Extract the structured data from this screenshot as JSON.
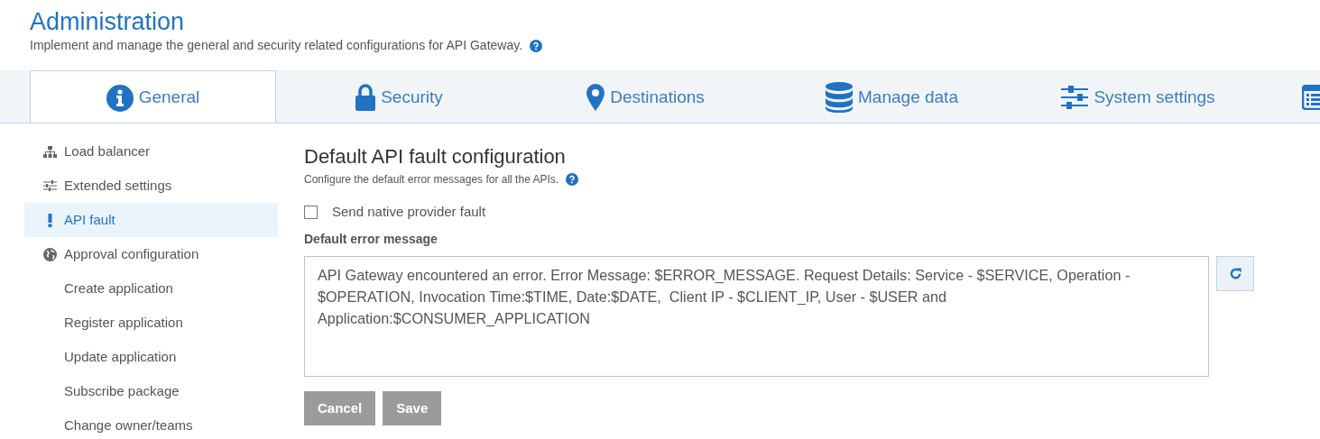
{
  "header": {
    "title": "Administration",
    "subtitle": "Implement and manage the general and security related configurations for API Gateway."
  },
  "tabs": [
    {
      "label": "General",
      "selected": true
    },
    {
      "label": "Security",
      "selected": false
    },
    {
      "label": "Destinations",
      "selected": false
    },
    {
      "label": "Manage data",
      "selected": false
    },
    {
      "label": "System settings",
      "selected": false
    },
    {
      "selected": false
    }
  ],
  "sidebar": {
    "items": [
      {
        "label": "Load balancer",
        "selected": false
      },
      {
        "label": "Extended settings",
        "selected": false
      },
      {
        "label": "API fault",
        "selected": true
      },
      {
        "label": "Approval configuration",
        "selected": false,
        "children": [
          {
            "label": "Create application",
            "selected": false
          },
          {
            "label": "Register application",
            "selected": false
          },
          {
            "label": "Update application",
            "selected": false
          },
          {
            "label": "Subscribe package",
            "selected": false
          },
          {
            "label": "Change owner/teams",
            "selected": false
          }
        ]
      }
    ]
  },
  "panel": {
    "title": "Default API fault configuration",
    "subtitle": "Configure the default error messages for all the APIs.",
    "checkbox": {
      "label": "Send native provider fault",
      "checked": false
    },
    "field_label": "Default error message",
    "message": "API Gateway encountered an error. Error Message: $ERROR_MESSAGE. Request Details: Service - $SERVICE, Operation - $OPERATION, Invocation Time:$TIME, Date:$DATE,  Client IP - $CLIENT_IP, User - $USER and Application:$CONSUMER_APPLICATION",
    "buttons": [
      {
        "label": "Cancel",
        "disabled": true
      },
      {
        "label": "Save",
        "disabled": true
      }
    ]
  }
}
